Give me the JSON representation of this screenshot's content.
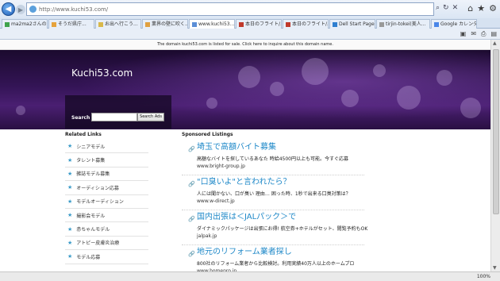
{
  "browser": {
    "address": "http://www.kuchi53.com/",
    "tabs": [
      {
        "label": "ma2ma2さんの...",
        "color": "#3fa34d"
      },
      {
        "label": "そうだ県庁...",
        "color": "#e6a23c"
      },
      {
        "label": "お出へ行こう...",
        "color": "#d8b84a"
      },
      {
        "label": "業界の壁に吹く...",
        "color": "#e0a040"
      },
      {
        "label": "www.kuchi53...",
        "color": "#5b8ed6",
        "active": true
      },
      {
        "label": "本日のフライト/...",
        "color": "#c0392b"
      },
      {
        "label": "本日のフライト/...",
        "color": "#c0392b"
      },
      {
        "label": "Dell Start Page",
        "color": "#2f7fd0"
      },
      {
        "label": "tirjin-tokei(美人...",
        "color": "#999999"
      },
      {
        "label": "Google カレンダー...",
        "color": "#4a86e8"
      }
    ],
    "zoom": "100%"
  },
  "page": {
    "sale_notice": "The domain kuchi53.com is listed for sale. Click here to inquire about this domain name.",
    "site_title": "Kuchi53.com",
    "search": {
      "label": "Search",
      "button": "Search Ads"
    },
    "related": {
      "title": "Related Links",
      "items": [
        "シニアモデル",
        "タレント募集",
        "雑誌モデル募集",
        "オーディション応募",
        "モデルオーディション",
        "撮影会モデル",
        "赤ちゃんモデル",
        "アトピー皮膚炎治療",
        "モデル応募"
      ]
    },
    "sponsored": {
      "title": "Sponsored Listings",
      "listings": [
        {
          "title": "埼玉で高額バイト募集",
          "desc": "高額なバイトを探しているあなた 時給4500円以上も可能。今すぐ応募",
          "url": "www.bright-group.jp"
        },
        {
          "title": "\"口臭いよ\"と言われたら？",
          "desc": "人には聞かない、口が臭い 理由… 困った時、1秒で出来る口臭対策は？",
          "url": "www.w-direct.jp"
        },
        {
          "title": "国内出張は＜JALパック＞で",
          "desc": "ダイナミックパッケージは出張にお得! 航空券+ホテルがセット、閲覧予約もOK",
          "url": "jalpak.jp"
        },
        {
          "title": "地元のリフォーム業者探し",
          "desc": "800社のリフォーム業者から比較検討。利用実績40万人以上のホームプロ",
          "url": "www.homepro.jp"
        }
      ]
    }
  }
}
